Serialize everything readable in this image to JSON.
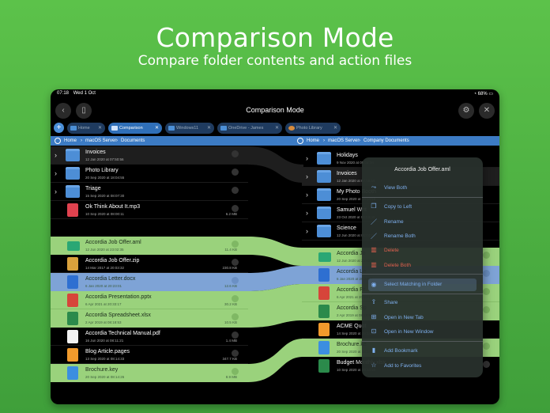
{
  "hero": {
    "title": "Comparison Mode",
    "subtitle": "Compare folder contents and action files"
  },
  "status": {
    "time": "07:18",
    "date": "Wed 1 Oct",
    "battery": "68%"
  },
  "window": {
    "title": "Comparison Mode"
  },
  "tabs": [
    {
      "label": "Home",
      "active": false
    },
    {
      "label": "Comparison",
      "active": true
    },
    {
      "label": "Windows11",
      "active": false
    },
    {
      "label": "OneDrive - James",
      "active": false
    },
    {
      "label": "Photo Library",
      "active": false
    }
  ],
  "left_path": [
    "Home",
    "macOS Server",
    "Documents"
  ],
  "right_path": [
    "Home",
    "macOS Server",
    "Company Documents"
  ],
  "left_rows": [
    {
      "name": "Invoices",
      "meta": "12 Jan 2020 at 07:50:56",
      "size": "",
      "kind": "folder",
      "state": "none"
    },
    {
      "name": "Photo Library",
      "meta": "20 Sep 2020 at 18:04:55",
      "size": "",
      "kind": "folder",
      "state": "none"
    },
    {
      "name": "Triage",
      "meta": "15 Sep 2020 at 08:07:30",
      "size": "",
      "kind": "folder",
      "state": "none"
    },
    {
      "name": "Ok Think About It.mp3",
      "meta": "10 Sep 2020 at 08:00:11",
      "size": "6.2 MB",
      "kind": "audio",
      "state": "none"
    },
    {
      "name": "Accordia Job Offer.aml",
      "meta": "12 Jun 2020 at 23:02:35",
      "size": "11.4 KB",
      "kind": "aml",
      "state": "green"
    },
    {
      "name": "Accordia Job Offer.zip",
      "meta": "14 Mar 2017 at 20:03:32",
      "size": "230.8 KB",
      "kind": "zip",
      "state": "none"
    },
    {
      "name": "Accordia Letter.docx",
      "meta": "6 Jan 2020 at 20:23:01",
      "size": "12.6 KB",
      "kind": "doc",
      "state": "blue"
    },
    {
      "name": "Accordia Presentation.pptx",
      "meta": "6 Apr 2021 at 20:33:17",
      "size": "30.2 KB",
      "kind": "ppt",
      "state": "green"
    },
    {
      "name": "Accordia Spreadsheet.xlsx",
      "meta": "2 Apr 2019 at 08:18:53",
      "size": "10.5 KB",
      "kind": "xls",
      "state": "green"
    },
    {
      "name": "Accordia Technical Manual.pdf",
      "meta": "16 Jun 2020 at 08:11:21",
      "size": "1.4 MB",
      "kind": "pdf",
      "state": "none"
    },
    {
      "name": "Blog Article.pages",
      "meta": "13 Sep 2020 at 08:14:33",
      "size": "347.7 KB",
      "kind": "pages",
      "state": "none"
    },
    {
      "name": "Brochure.key",
      "meta": "20 Sep 2020 at 08:14:26",
      "size": "8.9 MB",
      "kind": "key",
      "state": "green"
    }
  ],
  "right_rows": [
    {
      "name": "Holidays",
      "meta": "9 Nov 2020 at 08:04:00",
      "kind": "folder",
      "state": "none"
    },
    {
      "name": "Invoices",
      "meta": "12 Jan 2020 at 07:50:56",
      "kind": "folder",
      "state": "none"
    },
    {
      "name": "My Photo Booth",
      "meta": "20 Sep 2020 at 08:04:55",
      "kind": "folder",
      "state": "none"
    },
    {
      "name": "Samuel Writ",
      "meta": "23 Oct 2020 at 08:04:00",
      "kind": "folder",
      "state": "none"
    },
    {
      "name": "Science",
      "meta": "12 Jun 2020 at 08:04:00",
      "kind": "folder",
      "state": "none"
    },
    {
      "name": "Accordia Jo",
      "meta": "12 Jun 2020 at 23:02:35",
      "kind": "aml",
      "state": "green"
    },
    {
      "name": "Accordia Le",
      "meta": "6 Jan 2020 at 20:23:01",
      "kind": "doc",
      "state": "blue"
    },
    {
      "name": "Accordia Pr",
      "meta": "6 Apr 2021 at 20:33:17",
      "kind": "ppt",
      "state": "green"
    },
    {
      "name": "Accordia Sp",
      "meta": "2 Apr 2019 at 08:18:53",
      "kind": "xls",
      "state": "green"
    },
    {
      "name": "ACME Quot",
      "meta": "14 Sep 2020 at 08:14:33",
      "kind": "pages",
      "state": "none"
    },
    {
      "name": "Brochure.ke",
      "meta": "20 Sep 2020 at 08:14:26",
      "kind": "key",
      "state": "green"
    },
    {
      "name": "Budget Monthly.xlsx",
      "meta": "10 Sep 2020 at 08:14:22",
      "kind": "xls",
      "state": "none"
    }
  ],
  "context_menu": {
    "title": "Accordia Job Offer.aml",
    "items": [
      {
        "label": "View Both",
        "icon": "compare-icon",
        "style": "action"
      },
      {
        "label": "Copy to Left",
        "icon": "copy-icon",
        "style": "action"
      },
      {
        "label": "Rename",
        "icon": "pencil-icon",
        "style": "action"
      },
      {
        "label": "Rename Both",
        "icon": "pencil-icon",
        "style": "action"
      },
      {
        "label": "Delete",
        "icon": "trash-icon",
        "style": "danger"
      },
      {
        "label": "Delete Both",
        "icon": "trash-icon",
        "style": "danger"
      },
      {
        "label": "Select Matching in Folder",
        "icon": "check-circle-icon",
        "style": "highlight"
      },
      {
        "label": "Share",
        "icon": "share-icon",
        "style": "action"
      },
      {
        "label": "Open in New Tab",
        "icon": "new-tab-icon",
        "style": "action"
      },
      {
        "label": "Open in New Window",
        "icon": "new-window-icon",
        "style": "action"
      },
      {
        "label": "Add Bookmark",
        "icon": "bookmark-icon",
        "style": "action"
      },
      {
        "label": "Add to Favorites",
        "icon": "star-icon",
        "style": "action"
      }
    ]
  },
  "colors": {
    "match_green": "#9ad27c",
    "match_blue": "#7ea3d6",
    "accent": "#3c7bc4",
    "danger": "#e0604f"
  }
}
